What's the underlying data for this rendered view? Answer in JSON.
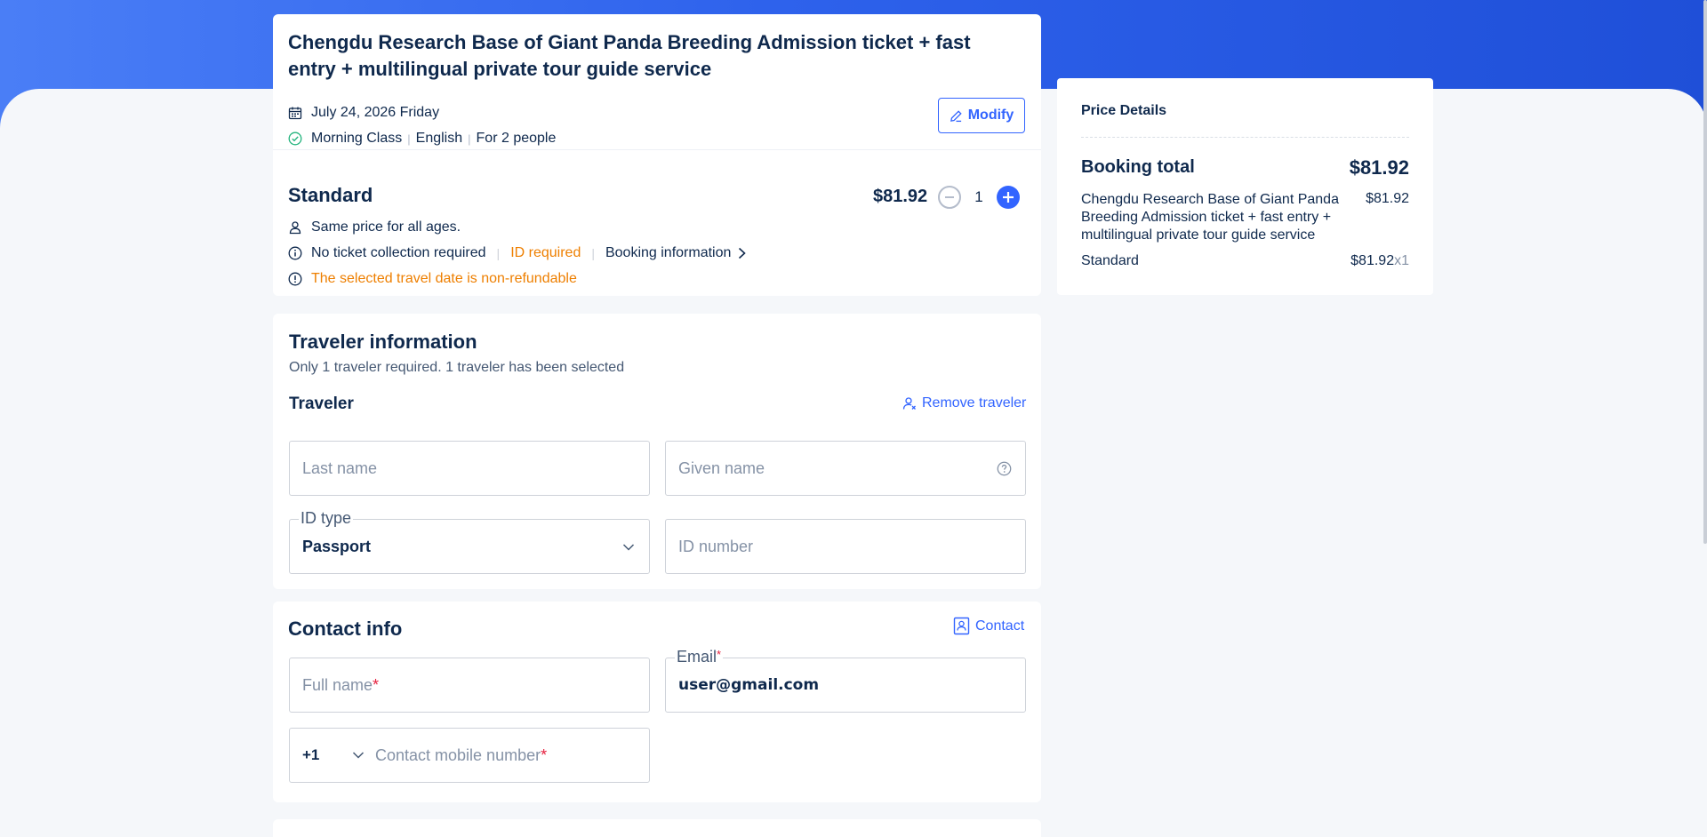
{
  "product": {
    "title": "Chengdu Research Base of Giant Panda Breeding Admission ticket + fast entry + multilingual private tour guide service",
    "date": "July 24, 2026 Friday",
    "session": "Morning Class",
    "language": "English",
    "party": "For 2 people",
    "modify_label": "Modify"
  },
  "package": {
    "name": "Standard",
    "price": "$81.92",
    "quantity": "1",
    "age_note": "Same price for all ages.",
    "collection_note": "No ticket collection required",
    "id_note": "ID required",
    "booking_info_label": "Booking information",
    "refund_note": "The selected travel date is non-refundable"
  },
  "traveler_section": {
    "title": "Traveler information",
    "subtitle": "Only 1 traveler required. 1 traveler has been selected",
    "traveler_label": "Traveler",
    "remove_label": "Remove traveler",
    "last_name_placeholder": "Last name",
    "given_name_placeholder": "Given name",
    "id_type_label": "ID type",
    "id_type_value": "Passport",
    "id_number_placeholder": "ID number"
  },
  "contact_section": {
    "title": "Contact info",
    "contact_link": "Contact",
    "full_name_placeholder": "Full name",
    "email_label": "Email",
    "email_value": "user@gmail.com",
    "country_code": "+1",
    "mobile_placeholder": "Contact mobile number",
    "required_mark": "*"
  },
  "price_details": {
    "title": "Price Details",
    "total_label": "Booking total",
    "total_value": "$81.92",
    "item_name": "Chengdu Research Base of Giant Panda Breeding Admission ticket + fast entry + multilingual private tour guide service",
    "item_value": "$81.92",
    "line_name": "Standard",
    "line_value": "$81.92",
    "line_multiplier": "x1"
  },
  "colors": {
    "accent": "#3264ff",
    "warning": "#ee7f00",
    "required": "#e6213f",
    "text": "#0f294d"
  }
}
